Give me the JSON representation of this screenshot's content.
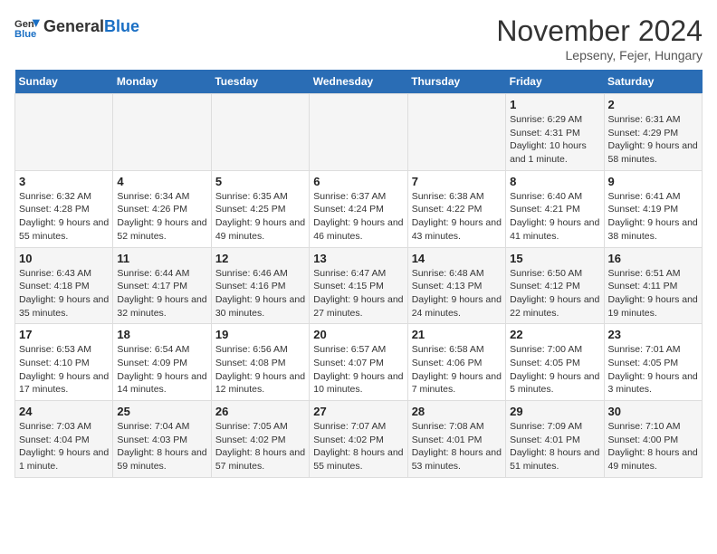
{
  "header": {
    "logo_general": "General",
    "logo_blue": "Blue",
    "month": "November 2024",
    "location": "Lepseny, Fejer, Hungary"
  },
  "days_of_week": [
    "Sunday",
    "Monday",
    "Tuesday",
    "Wednesday",
    "Thursday",
    "Friday",
    "Saturday"
  ],
  "weeks": [
    [
      {
        "day": "",
        "detail": ""
      },
      {
        "day": "",
        "detail": ""
      },
      {
        "day": "",
        "detail": ""
      },
      {
        "day": "",
        "detail": ""
      },
      {
        "day": "",
        "detail": ""
      },
      {
        "day": "1",
        "detail": "Sunrise: 6:29 AM\nSunset: 4:31 PM\nDaylight: 10 hours and 1 minute."
      },
      {
        "day": "2",
        "detail": "Sunrise: 6:31 AM\nSunset: 4:29 PM\nDaylight: 9 hours and 58 minutes."
      }
    ],
    [
      {
        "day": "3",
        "detail": "Sunrise: 6:32 AM\nSunset: 4:28 PM\nDaylight: 9 hours and 55 minutes."
      },
      {
        "day": "4",
        "detail": "Sunrise: 6:34 AM\nSunset: 4:26 PM\nDaylight: 9 hours and 52 minutes."
      },
      {
        "day": "5",
        "detail": "Sunrise: 6:35 AM\nSunset: 4:25 PM\nDaylight: 9 hours and 49 minutes."
      },
      {
        "day": "6",
        "detail": "Sunrise: 6:37 AM\nSunset: 4:24 PM\nDaylight: 9 hours and 46 minutes."
      },
      {
        "day": "7",
        "detail": "Sunrise: 6:38 AM\nSunset: 4:22 PM\nDaylight: 9 hours and 43 minutes."
      },
      {
        "day": "8",
        "detail": "Sunrise: 6:40 AM\nSunset: 4:21 PM\nDaylight: 9 hours and 41 minutes."
      },
      {
        "day": "9",
        "detail": "Sunrise: 6:41 AM\nSunset: 4:19 PM\nDaylight: 9 hours and 38 minutes."
      }
    ],
    [
      {
        "day": "10",
        "detail": "Sunrise: 6:43 AM\nSunset: 4:18 PM\nDaylight: 9 hours and 35 minutes."
      },
      {
        "day": "11",
        "detail": "Sunrise: 6:44 AM\nSunset: 4:17 PM\nDaylight: 9 hours and 32 minutes."
      },
      {
        "day": "12",
        "detail": "Sunrise: 6:46 AM\nSunset: 4:16 PM\nDaylight: 9 hours and 30 minutes."
      },
      {
        "day": "13",
        "detail": "Sunrise: 6:47 AM\nSunset: 4:15 PM\nDaylight: 9 hours and 27 minutes."
      },
      {
        "day": "14",
        "detail": "Sunrise: 6:48 AM\nSunset: 4:13 PM\nDaylight: 9 hours and 24 minutes."
      },
      {
        "day": "15",
        "detail": "Sunrise: 6:50 AM\nSunset: 4:12 PM\nDaylight: 9 hours and 22 minutes."
      },
      {
        "day": "16",
        "detail": "Sunrise: 6:51 AM\nSunset: 4:11 PM\nDaylight: 9 hours and 19 minutes."
      }
    ],
    [
      {
        "day": "17",
        "detail": "Sunrise: 6:53 AM\nSunset: 4:10 PM\nDaylight: 9 hours and 17 minutes."
      },
      {
        "day": "18",
        "detail": "Sunrise: 6:54 AM\nSunset: 4:09 PM\nDaylight: 9 hours and 14 minutes."
      },
      {
        "day": "19",
        "detail": "Sunrise: 6:56 AM\nSunset: 4:08 PM\nDaylight: 9 hours and 12 minutes."
      },
      {
        "day": "20",
        "detail": "Sunrise: 6:57 AM\nSunset: 4:07 PM\nDaylight: 9 hours and 10 minutes."
      },
      {
        "day": "21",
        "detail": "Sunrise: 6:58 AM\nSunset: 4:06 PM\nDaylight: 9 hours and 7 minutes."
      },
      {
        "day": "22",
        "detail": "Sunrise: 7:00 AM\nSunset: 4:05 PM\nDaylight: 9 hours and 5 minutes."
      },
      {
        "day": "23",
        "detail": "Sunrise: 7:01 AM\nSunset: 4:05 PM\nDaylight: 9 hours and 3 minutes."
      }
    ],
    [
      {
        "day": "24",
        "detail": "Sunrise: 7:03 AM\nSunset: 4:04 PM\nDaylight: 9 hours and 1 minute."
      },
      {
        "day": "25",
        "detail": "Sunrise: 7:04 AM\nSunset: 4:03 PM\nDaylight: 8 hours and 59 minutes."
      },
      {
        "day": "26",
        "detail": "Sunrise: 7:05 AM\nSunset: 4:02 PM\nDaylight: 8 hours and 57 minutes."
      },
      {
        "day": "27",
        "detail": "Sunrise: 7:07 AM\nSunset: 4:02 PM\nDaylight: 8 hours and 55 minutes."
      },
      {
        "day": "28",
        "detail": "Sunrise: 7:08 AM\nSunset: 4:01 PM\nDaylight: 8 hours and 53 minutes."
      },
      {
        "day": "29",
        "detail": "Sunrise: 7:09 AM\nSunset: 4:01 PM\nDaylight: 8 hours and 51 minutes."
      },
      {
        "day": "30",
        "detail": "Sunrise: 7:10 AM\nSunset: 4:00 PM\nDaylight: 8 hours and 49 minutes."
      }
    ]
  ]
}
